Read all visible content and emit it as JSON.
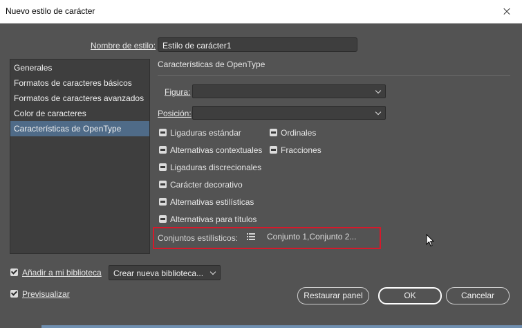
{
  "window": {
    "title": "Nuevo estilo de carácter"
  },
  "style_name": {
    "label": "Nombre de estilo:",
    "value": "Estilo de carácter1"
  },
  "sidebar": {
    "items": [
      {
        "label": "Generales"
      },
      {
        "label": "Formatos de caracteres básicos"
      },
      {
        "label": "Formatos de caracteres avanzados"
      },
      {
        "label": "Color de caracteres"
      },
      {
        "label": "Características de OpenType",
        "selected": true
      }
    ]
  },
  "panel": {
    "title": "Características de OpenType",
    "figura": {
      "label": "Figura:",
      "value": ""
    },
    "posicion": {
      "label": "Posición:",
      "value": ""
    },
    "checkboxes_left": [
      {
        "label": "Ligaduras estándar",
        "state": "mixed"
      },
      {
        "label": "Alternativas contextuales",
        "state": "mixed"
      },
      {
        "label": "Ligaduras discrecionales",
        "state": "mixed"
      },
      {
        "label": "Carácter decorativo",
        "state": "mixed"
      },
      {
        "label": "Alternativas estilísticas",
        "state": "mixed"
      },
      {
        "label": "Alternativas para títulos",
        "state": "mixed"
      }
    ],
    "checkboxes_right": [
      {
        "label": "Ordinales",
        "state": "mixed"
      },
      {
        "label": "Fracciones",
        "state": "mixed"
      }
    ],
    "stylistic_sets": {
      "label": "Conjuntos estilísticos:",
      "value": "Conjunto 1,Conjunto 2..."
    }
  },
  "footer": {
    "add_to_library": {
      "label": "Añadir a mi biblioteca",
      "checked": true
    },
    "library_select": {
      "value": "Crear nueva biblioteca..."
    },
    "preview": {
      "label": "Previsualizar",
      "checked": true
    },
    "buttons": {
      "restore": "Restaurar panel",
      "ok": "OK",
      "cancel": "Cancelar"
    }
  },
  "colors": {
    "background": "#535353",
    "selection": "#4f6b88",
    "highlight": "#d6192b"
  }
}
